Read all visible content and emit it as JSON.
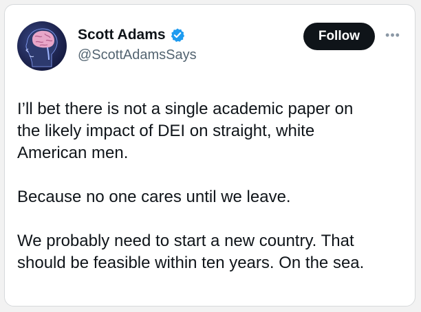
{
  "author": {
    "display_name": "Scott Adams",
    "handle": "@ScottAdamsSays",
    "verified": true,
    "avatar_icon": "brain-profile-avatar"
  },
  "actions": {
    "follow_label": "Follow",
    "more_icon": "more-options-icon",
    "more_glyph": "•••"
  },
  "post": {
    "paragraphs": [
      "I’ll bet there is not a single academic paper on\nthe likely impact of DEI on straight, white\nAmerican men.",
      "Because no one cares until we leave.",
      "We probably need to start a new country. That\nshould be feasible within ten years. On the sea."
    ]
  },
  "colors": {
    "verified": "#1d9bf0",
    "follow_bg": "#0f1419",
    "text_primary": "#0f1419",
    "text_secondary": "#536471"
  }
}
